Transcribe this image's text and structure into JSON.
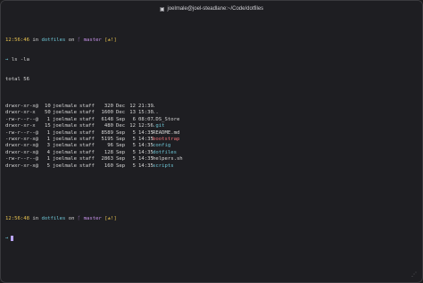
{
  "window": {
    "title": "joelmale@joel-steadlane:~/Code/dotfiles",
    "icon": "terminal-icon"
  },
  "prompt1": {
    "time": "12:56:46",
    "in": "in",
    "dir": "dotfiles",
    "on": "on",
    "branch_icon": "git-branch-icon",
    "branch": "master",
    "status": "[±!]",
    "arrow": "→",
    "command": "ls -la"
  },
  "total": "total 56",
  "listing": [
    {
      "perm": "drwxr-xr-x@",
      "links": "10",
      "owner": "joelmale",
      "group": "staff",
      "size": "320",
      "month": "Dec",
      "day": "12",
      "clock": "21:39",
      "name": ".",
      "color": "c-gray"
    },
    {
      "perm": "drwxr-xr-x",
      "links": "50",
      "owner": "joelmale",
      "group": "staff",
      "size": "1600",
      "month": "Dec",
      "day": "13",
      "clock": "15:30",
      "name": "..",
      "color": "c-gray"
    },
    {
      "perm": "-rw-r--r--@",
      "links": "1",
      "owner": "joelmale",
      "group": "staff",
      "size": "6148",
      "month": "Sep",
      "day": "6",
      "clock": "08:07",
      "name": ".DS_Store",
      "color": "c-gray"
    },
    {
      "perm": "drwxr-xr-x",
      "links": "15",
      "owner": "joelmale",
      "group": "staff",
      "size": "480",
      "month": "Dec",
      "day": "12",
      "clock": "12:56",
      "name": ".git",
      "color": "c-dirname"
    },
    {
      "perm": "-rw-r--r--@",
      "links": "1",
      "owner": "joelmale",
      "group": "staff",
      "size": "8589",
      "month": "Sep",
      "day": "5",
      "clock": "14:35",
      "name": "README.md",
      "color": "c-gray"
    },
    {
      "perm": "-rwxr-xr-x@",
      "links": "1",
      "owner": "joelmale",
      "group": "staff",
      "size": "5195",
      "month": "Sep",
      "day": "5",
      "clock": "14:35",
      "name": "bootstrap",
      "color": "c-red"
    },
    {
      "perm": "drwxr-xr-x@",
      "links": "3",
      "owner": "joelmale",
      "group": "staff",
      "size": "96",
      "month": "Sep",
      "day": "5",
      "clock": "14:35",
      "name": "config",
      "color": "c-dirname"
    },
    {
      "perm": "drwxr-xr-x@",
      "links": "4",
      "owner": "joelmale",
      "group": "staff",
      "size": "128",
      "month": "Sep",
      "day": "5",
      "clock": "14:35",
      "name": "dotfiles",
      "color": "c-dirname"
    },
    {
      "perm": "-rw-r--r--@",
      "links": "1",
      "owner": "joelmale",
      "group": "staff",
      "size": "2863",
      "month": "Sep",
      "day": "5",
      "clock": "14:35",
      "name": "helpers.sh",
      "color": "c-gray"
    },
    {
      "perm": "drwxr-xr-x@",
      "links": "5",
      "owner": "joelmale",
      "group": "staff",
      "size": "160",
      "month": "Sep",
      "day": "5",
      "clock": "14:35",
      "name": "scripts",
      "color": "c-dirname"
    }
  ],
  "prompt2": {
    "time": "12:56:48",
    "in": "in",
    "dir": "dotfiles",
    "on": "on",
    "branch_icon": "git-branch-icon",
    "branch": "master",
    "status": "[±!]",
    "arrow": "→"
  },
  "colors": {
    "background": "#1e1e22",
    "time": "#e6c14f",
    "dir": "#6ec6d6",
    "branch": "#c792ea",
    "red": "#f07178",
    "cursor": "#b9a4ff"
  }
}
